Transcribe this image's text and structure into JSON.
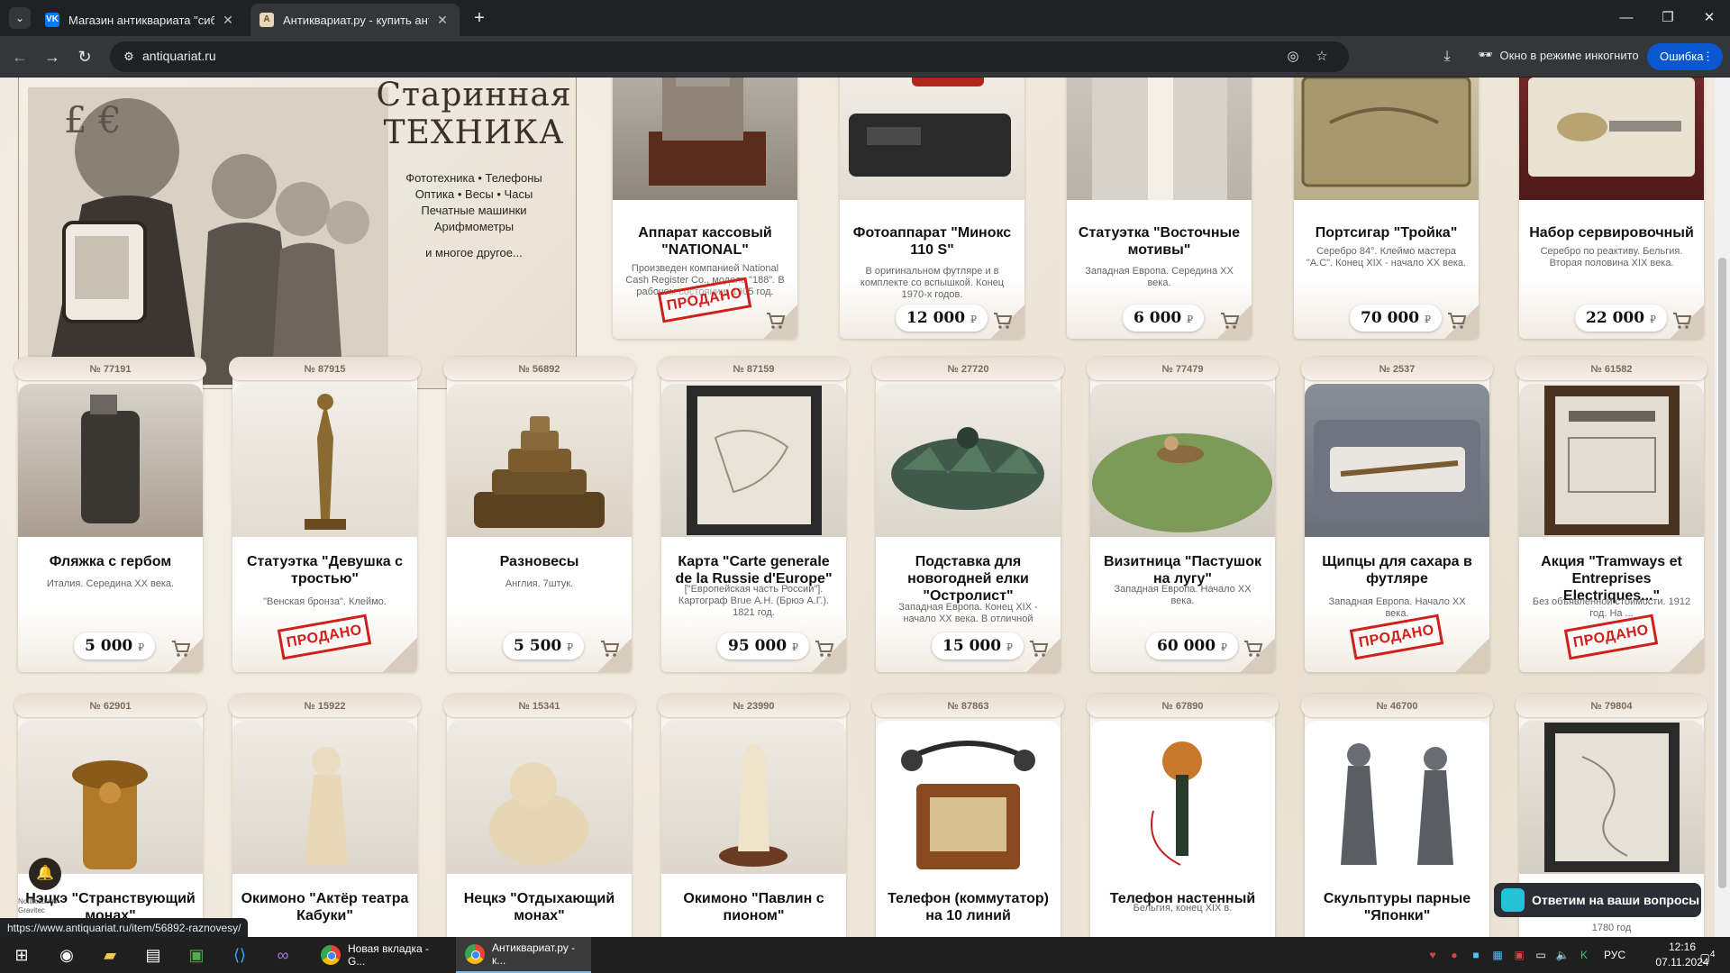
{
  "browser": {
    "tabs": [
      {
        "title": "Магазин антиквариата \"сибир",
        "favicon": "vk-icon"
      },
      {
        "title": "Антиквариат.ру - купить анти",
        "favicon": "antiquariat-icon"
      }
    ],
    "url": "antiquariat.ru",
    "incognito_label": "Окно в режиме инкогнито",
    "error_label": "Ошибка"
  },
  "banner": {
    "title_line1": "Старинная",
    "title_line2": "техника",
    "line1": "Фототехника • Телефоны",
    "line2": "Оптика • Весы • Часы",
    "line3": "Печатные машинки",
    "line4": "Арифмометры",
    "more": "и многое другое..."
  },
  "currency_symbol": "₽",
  "sold_label": "ПРОДАНО",
  "row1": [
    {
      "title": "Аппарат кассовый \"NATIONAL\"",
      "desc": "Произведен компанией National Cash Register Co., модель \"188\". В рабочем состоянии. 1905 год.",
      "price": "",
      "sold": true
    },
    {
      "title": "Фотоаппарат \"Минокс 110 S\"",
      "desc": "В оригинальном футляре и в комплекте со вспышкой. Конец 1970-х годов.",
      "price": "12 000",
      "sold": false
    },
    {
      "title": "Статуэтка \"Восточные мотивы\"",
      "desc": "Западная Европа. Середина XX века.",
      "price": "6 000",
      "sold": false
    },
    {
      "title": "Портсигар \"Тройка\"",
      "desc": "Серебро 84°. Клеймо мастера \"А.С\". Конец XIX - начало XX века.",
      "price": "70 000",
      "sold": false
    },
    {
      "title": "Набор сервировочный",
      "desc": "Серебро по реактиву. Бельгия. Вторая половина XIX века.",
      "price": "22 000",
      "sold": false
    }
  ],
  "row2": [
    {
      "num": "№ 77191",
      "title": "Фляжка с гербом",
      "desc": "Италия. Середина XX века.",
      "price": "5 000",
      "sold": false
    },
    {
      "num": "№ 87915",
      "title": "Статуэтка \"Девушка с тростью\"",
      "desc": "\"Венская бронза\". Клеймо.",
      "price": "",
      "sold": true
    },
    {
      "num": "№ 56892",
      "title": "Разновесы",
      "desc": "Англия. 7штук.",
      "price": "5 500",
      "sold": false
    },
    {
      "num": "№ 87159",
      "title": "Карта \"Carte generale de la Russie d'Europe\"",
      "desc": "[\"Европейская часть России\"]. Картограф Brue А.Н. (Брюэ А.Г.). 1821 год.",
      "price": "95 000",
      "sold": false
    },
    {
      "num": "№ 27720",
      "title": "Подставка для новогодней елки \"Остролист\"",
      "desc": "Западная Европа. Конец XIX - начало XX века. В отличной",
      "price": "15 000",
      "sold": false
    },
    {
      "num": "№ 77479",
      "title": "Визитница \"Пастушок на лугу\"",
      "desc": "Западная Европа. Начало XX века.",
      "price": "60 000",
      "sold": false
    },
    {
      "num": "№ 2537",
      "title": "Щипцы для сахара в футляре",
      "desc": "Западная Европа. Начало XX века.",
      "price": "",
      "sold": true
    },
    {
      "num": "№ 61582",
      "title": "Акция \"Tramways et Entreprises Electriques...\"",
      "desc": "Без объявленной стоимости. 1912 год. На ...",
      "price": "",
      "sold": true
    }
  ],
  "row3": [
    {
      "num": "№ 62901",
      "title": "Нэцкэ \"Странствующий монах\"",
      "desc": ""
    },
    {
      "num": "№ 15922",
      "title": "Окимоно \"Актёр театра Кабуки\"",
      "desc": ""
    },
    {
      "num": "№ 15341",
      "title": "Нецкэ \"Отдыхающий монах\"",
      "desc": ""
    },
    {
      "num": "№ 23990",
      "title": "Окимоно \"Павлин с пионом\"",
      "desc": ""
    },
    {
      "num": "№ 87863",
      "title": "Телефон (коммутатор) на 10 линий",
      "desc": ""
    },
    {
      "num": "№ 67890",
      "title": "Телефон настенный",
      "desc": "Бельгия, конец XIX в."
    },
    {
      "num": "№ 46700",
      "title": "Скульптуры парные \"Японки\"",
      "desc": ""
    },
    {
      "num": "№ 79804",
      "title": "",
      "desc": "1780 год"
    }
  ],
  "chat_widget": "Ответим на ваши вопросы",
  "status_url": "https://www.antiquariat.ru/item/56892-raznovesy/",
  "bell_label": "Notifications\nGravitec",
  "taskbar": {
    "apps": [
      {
        "title": "Новая вкладка - G..."
      },
      {
        "title": "Антиквариат.ру - к..."
      }
    ],
    "lang": "РУС",
    "time": "12:16",
    "date": "07.11.2024",
    "notif_count": "4"
  }
}
